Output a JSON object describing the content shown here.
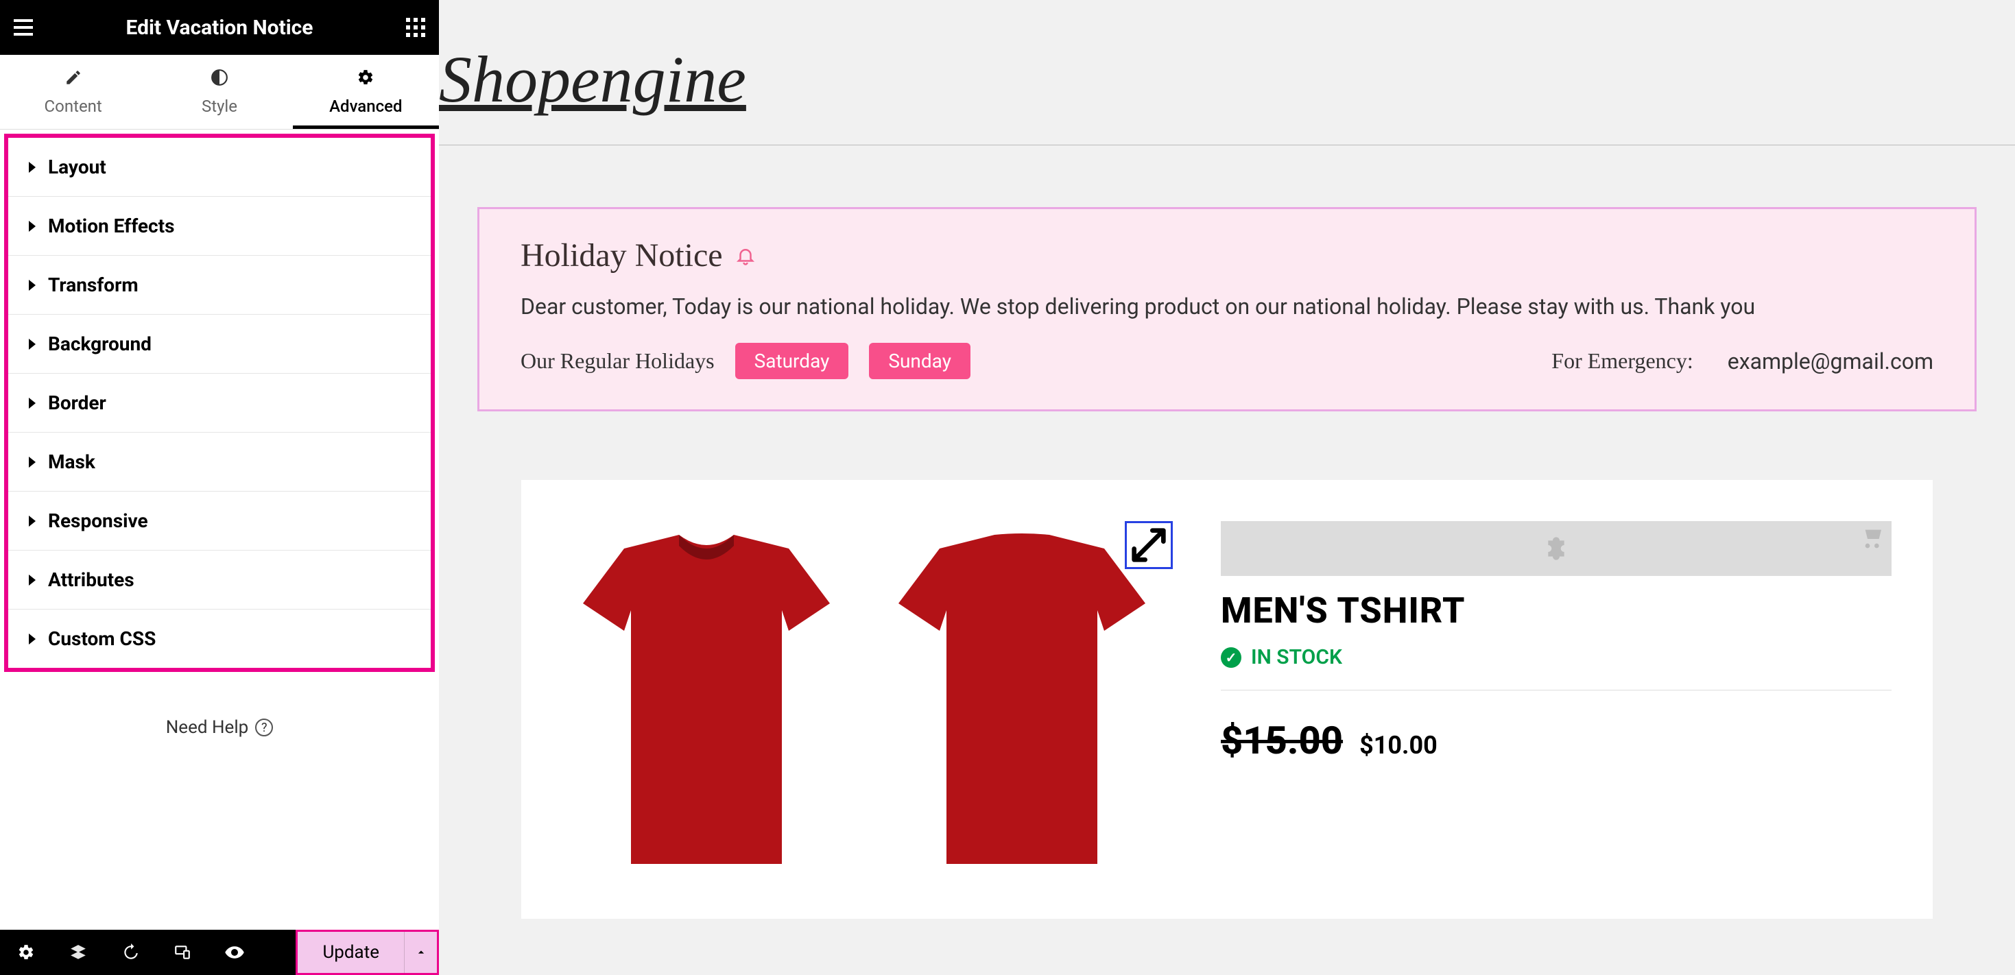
{
  "sidebar": {
    "title": "Edit Vacation Notice",
    "tabs": [
      {
        "label": "Content"
      },
      {
        "label": "Style"
      },
      {
        "label": "Advanced"
      }
    ],
    "sections": [
      {
        "label": "Layout"
      },
      {
        "label": "Motion Effects"
      },
      {
        "label": "Transform"
      },
      {
        "label": "Background"
      },
      {
        "label": "Border"
      },
      {
        "label": "Mask"
      },
      {
        "label": "Responsive"
      },
      {
        "label": "Attributes"
      },
      {
        "label": "Custom CSS"
      }
    ],
    "need_help": "Need Help",
    "update_label": "Update"
  },
  "canvas": {
    "brand": "Shopengine",
    "notice": {
      "title": "Holiday Notice",
      "message": "Dear customer, Today is our national holiday. We stop delivering product on our national holiday. Please stay with us. Thank you",
      "regular_label": "Our Regular Holidays",
      "days": [
        "Saturday",
        "Sunday"
      ],
      "emergency_label": "For Emergency:",
      "emergency_email": "example@gmail.com"
    },
    "product": {
      "title": "MEN'S TSHIRT",
      "stock": "IN STOCK",
      "old_price": "$15.00",
      "new_price": "$10.00"
    }
  }
}
